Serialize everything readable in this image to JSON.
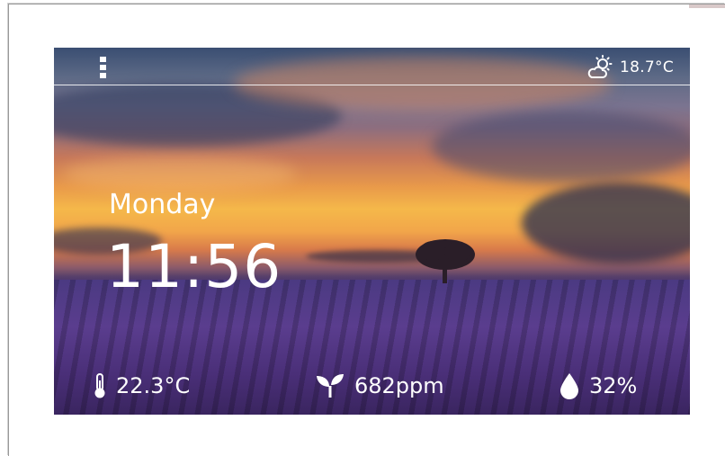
{
  "header": {
    "menu_icon": "kebab-menu-icon",
    "weather_icon": "partly-cloudy-sun-icon",
    "outdoor_temperature": "18.7°C"
  },
  "main": {
    "day": "Monday",
    "time": "11:56"
  },
  "sensors": {
    "temperature": {
      "icon": "thermometer-icon",
      "value": "22.3°C"
    },
    "co2": {
      "icon": "sprout-icon",
      "value": "682ppm"
    },
    "humidity": {
      "icon": "water-drop-icon",
      "value": "32%"
    }
  },
  "colors": {
    "text": "#ffffff",
    "sky_orange": "#f5b84a",
    "lavender": "#5a3d8e"
  }
}
